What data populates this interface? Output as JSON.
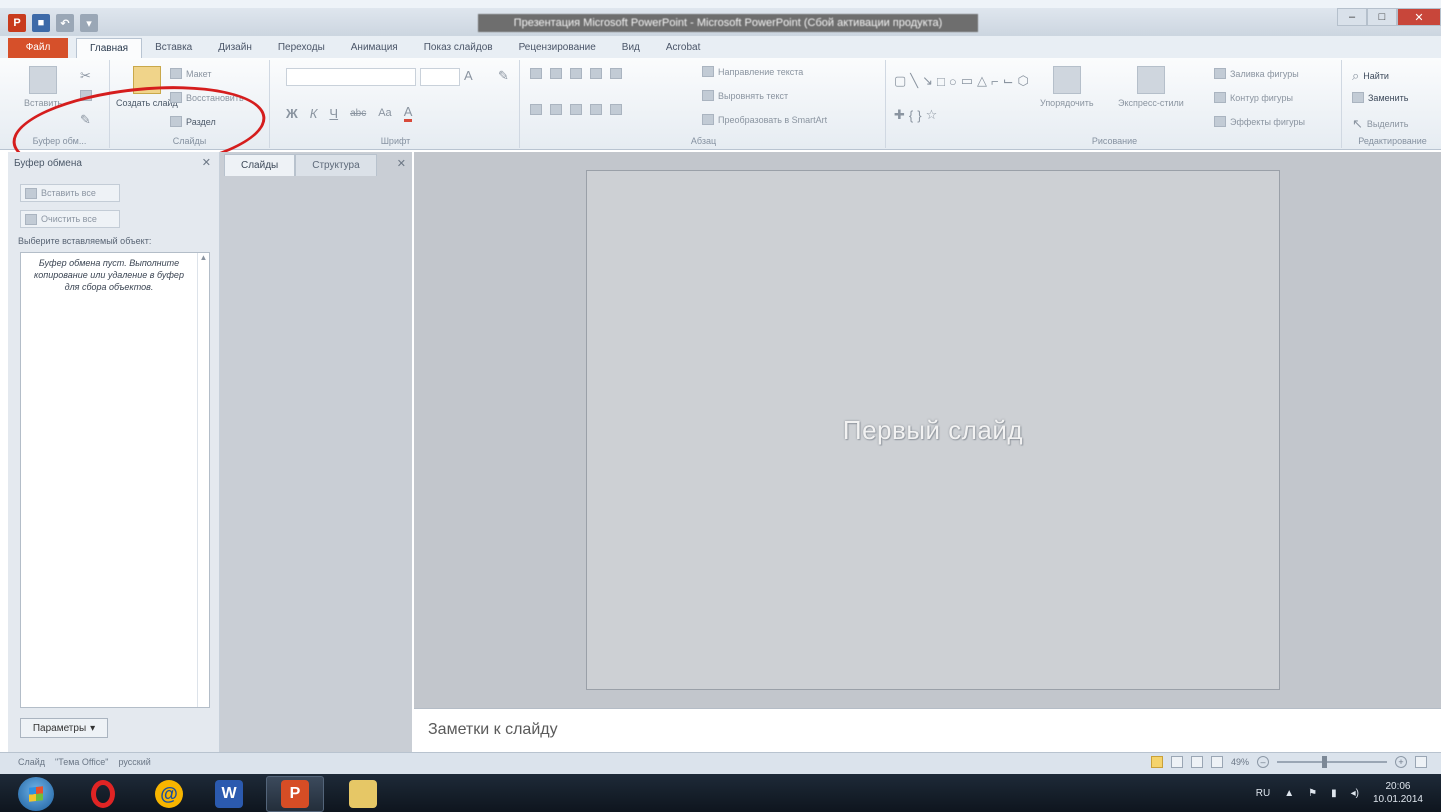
{
  "window": {
    "title": "Презентация Microsoft PowerPoint - Microsoft PowerPoint (Сбой активации продукта)",
    "controls": {
      "minimize": "–",
      "maximize": "□",
      "close": "✕"
    }
  },
  "quick_access": {
    "app_glyph": "P",
    "save_glyph": "■",
    "undo_glyph": "↶",
    "redo_glyph": "▾"
  },
  "tabs": [
    {
      "label": "Файл"
    },
    {
      "label": "Главная"
    },
    {
      "label": "Вставка"
    },
    {
      "label": "Дизайн"
    },
    {
      "label": "Переходы"
    },
    {
      "label": "Анимация"
    },
    {
      "label": "Показ слайдов"
    },
    {
      "label": "Рецензирование"
    },
    {
      "label": "Вид"
    },
    {
      "label": "Acrobat"
    }
  ],
  "ribbon": {
    "clipboard": {
      "label": "Буфер обм...",
      "paste": "Вставить"
    },
    "slides": {
      "label": "Слайды",
      "new_slide": "Создать слайд",
      "layout": "Макет",
      "reset": "Восстановить",
      "section": "Раздел"
    },
    "font": {
      "label": "Шрифт",
      "bold": "Ж",
      "italic": "К",
      "underline": "Ч",
      "strike": "abc",
      "change_case": "Aa",
      "font_color": "A"
    },
    "paragraph": {
      "label": "Абзац",
      "text_direction": "Направление текста",
      "align_text": "Выровнять текст",
      "smartart": "Преобразовать в SmartArt"
    },
    "drawing": {
      "label": "Рисование",
      "arrange": "Упорядочить",
      "quick_styles": "Экспресс-стили",
      "fill": "Заливка фигуры",
      "outline": "Контур фигуры",
      "effects": "Эффекты фигуры"
    },
    "editing": {
      "label": "Редактирование",
      "find": "Найти",
      "replace": "Заменить",
      "select": "Выделить"
    }
  },
  "clipboard_pane": {
    "title": "Буфер обмена",
    "close_glyph": "✕",
    "paste_all": "Вставить все",
    "clear_all": "Очистить все",
    "hint": "Выберите вставляемый объект:",
    "empty_message": "Буфер обмена пуст. Выполните копирование или удаление в буфер для сбора объектов.",
    "options": "Параметры"
  },
  "slides_pane": {
    "tab_slides": "Слайды",
    "tab_outline": "Структура",
    "close_glyph": "✕"
  },
  "slide": {
    "title": "Первый слайд"
  },
  "notes": {
    "placeholder": "Заметки к слайду"
  },
  "status": {
    "slide": "Слайд",
    "theme": "\"Тема Office\"",
    "language": "русский",
    "zoom": "49%"
  },
  "taskbar": {
    "apps": [
      "start",
      "opera",
      "mail-ru",
      "word",
      "powerpoint",
      "explorer"
    ]
  },
  "tray": {
    "language": "RU",
    "time": "20:06",
    "date": "10.01.2014"
  },
  "colors": {
    "file_tab": "#d6502a",
    "annotation": "#d51d1d"
  }
}
